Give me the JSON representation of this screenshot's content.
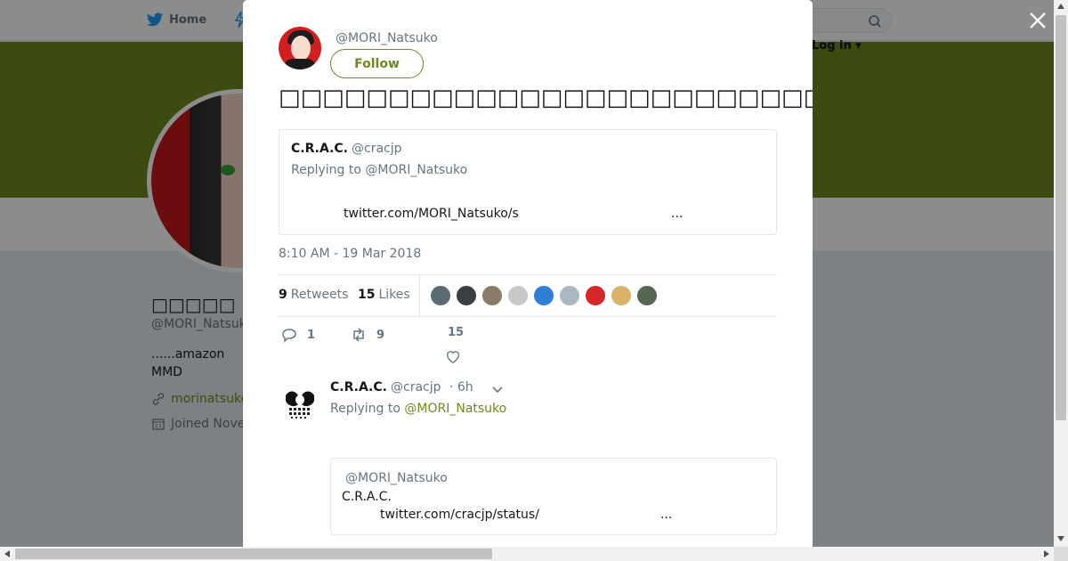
{
  "background": {
    "nav_home_label": "Home",
    "login_label": "Log in",
    "profile_name": "□□□□□",
    "profile_handle": "@MORI_Natsuko",
    "bio_line1": "......amazon",
    "bio_line2": "MMD",
    "url": "morinatsuko",
    "joined": "Joined Nove"
  },
  "tweet": {
    "handle": "@MORI_Natsuko",
    "follow_label": "Follow",
    "text": "□□□□□□□□□□□□□□□□□□□□□□□□□□□□□□C.R.A.C.□□□□□□□□□□□□□□□□□□□□□□□□□□□",
    "quote": {
      "name": "C.R.A.C.",
      "handle": "@cracjp",
      "replying_to": "Replying to @MORI_Natsuko",
      "link": "twitter.com/MORI_Natsuko/s",
      "ellipsis": "..."
    },
    "timestamp": "8:10 AM - 19 Mar 2018",
    "retweets_count": "9",
    "retweets_label": "Retweets",
    "likes_count": "15",
    "likes_label": "Likes",
    "likers": [
      "#5b6b74",
      "#3a3f44",
      "#8a7a66",
      "#c8c8c8",
      "#2f7fd6",
      "#aab8c2",
      "#d62828",
      "#d9b36b",
      "#556655"
    ],
    "actions": {
      "reply_count": "1",
      "retweet_count": "9",
      "like_count": "15"
    }
  },
  "reply": {
    "name": "C.R.A.C.",
    "handle": "@cracjp",
    "time": "· 6h",
    "replying_prefix": "Replying to",
    "replying_handle": "@MORI_Natsuko",
    "quote_handle": "@MORI_Natsuko",
    "quote_name": "C.R.A.C.",
    "quote_link": "twitter.com/cracjp/status/",
    "quote_ellipsis": "..."
  },
  "colors": {
    "accent": "#6e8a1f",
    "twitter_blue": "#1da1f2",
    "muted": "#66757f"
  }
}
